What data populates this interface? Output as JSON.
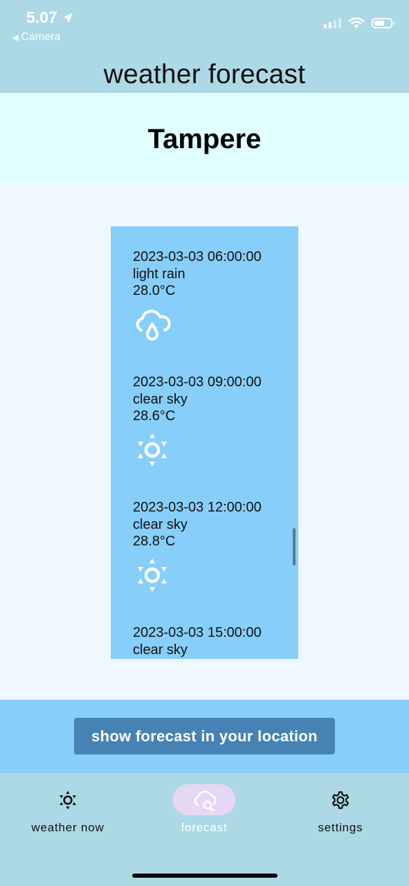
{
  "status_bar": {
    "time": "5.07",
    "back_label": "Camera",
    "back_arrow": "◀",
    "icons": [
      "location-arrow-icon",
      "signal-icon",
      "wifi-icon",
      "battery-icon"
    ]
  },
  "app_bar": {
    "title": "weather forecast"
  },
  "city": {
    "name": "Tampere"
  },
  "forecast": [
    {
      "datetime": "2023-03-03 06:00:00",
      "description": "light rain",
      "temperature": "28.0°C",
      "icon": "rain-cloud-icon"
    },
    {
      "datetime": "2023-03-03 09:00:00",
      "description": "clear sky",
      "temperature": "28.6°C",
      "icon": "sun-icon"
    },
    {
      "datetime": "2023-03-03 12:00:00",
      "description": "clear sky",
      "temperature": "28.8°C",
      "icon": "sun-icon"
    },
    {
      "datetime": "2023-03-03 15:00:00",
      "description": "clear sky",
      "temperature": "",
      "icon": ""
    }
  ],
  "location_button": {
    "label": "show forecast in your location"
  },
  "bottom_nav": {
    "items": [
      {
        "label": "weather now",
        "icon": "sun-outline-icon",
        "active": false
      },
      {
        "label": "forecast",
        "icon": "cloud-search-icon",
        "active": true
      },
      {
        "label": "settings",
        "icon": "gear-icon",
        "active": false
      }
    ]
  },
  "colors": {
    "app_bar": "#add8e6",
    "city_bar": "#e0ffff",
    "list_background": "#87cefa",
    "button": "#4682b4",
    "active_pill": "#e6d8f2",
    "page_background": "#f0f8ff"
  }
}
